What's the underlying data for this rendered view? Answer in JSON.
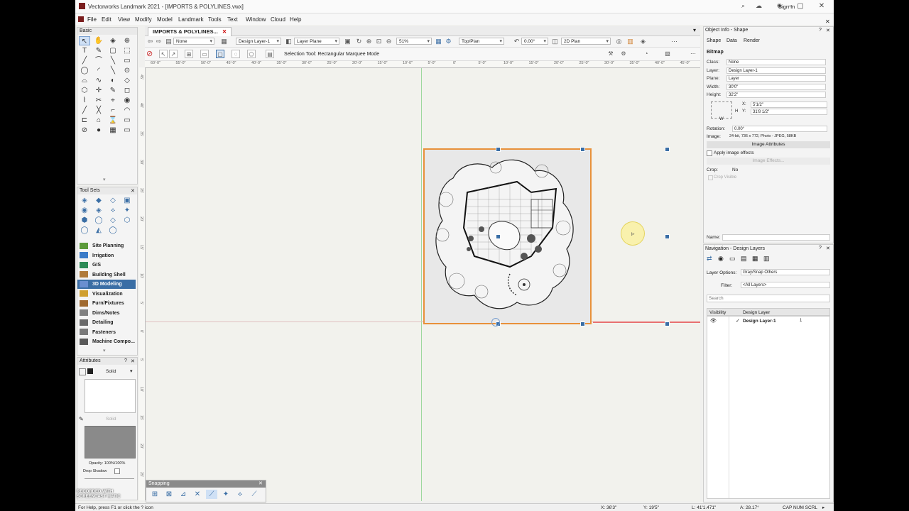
{
  "window": {
    "title": "Vectorworks Landmark 2021 - [IMPORTS & POLYLINES.vwx]",
    "sign_in": "Sign In"
  },
  "menu": [
    "File",
    "Edit",
    "View",
    "Modify",
    "Model",
    "Landmark",
    "Tools",
    "Text",
    "Window",
    "Cloud",
    "Help"
  ],
  "doc_tab": {
    "label": "IMPORTS & POLYLINES..."
  },
  "view_bar": {
    "class_value": "None",
    "layer_value": "Design Layer-1",
    "plane_value": "Layer Plane",
    "zoom_value": "51%",
    "view_value": "Top/Plan",
    "rotation_value": "0.00°",
    "render_value": "2D Plan"
  },
  "mode_bar": {
    "message": "Selection Tool: Rectangular Marquee Mode"
  },
  "ruler": {
    "h_labels": [
      "60'-0\"",
      "55'-0\"",
      "50'-0\"",
      "45'-0\"",
      "40'-0\"",
      "35'-0\"",
      "30'-0\"",
      "25'-0\"",
      "20'-0\"",
      "15'-0\"",
      "10'-0\"",
      "5'-0\"",
      "0'",
      "5'-0\"",
      "10'-0\"",
      "15'-0\"",
      "20'-0\"",
      "25'-0\"",
      "30'-0\"",
      "35'-0\"",
      "40'-0\"",
      "45'-0\""
    ],
    "v_labels": [
      "45'",
      "40'",
      "35'",
      "30'",
      "25'",
      "20'",
      "15'",
      "10'",
      "5'",
      "0'",
      "5'",
      "10'",
      "15'",
      "20'",
      "25'"
    ]
  },
  "basic_palette": {
    "title": "Basic"
  },
  "tool_sets": {
    "title": "Tool Sets",
    "items": [
      {
        "label": "Site Planning",
        "color": "#5b9a3a",
        "active": false
      },
      {
        "label": "Irrigation",
        "color": "#3a7bc8",
        "active": false
      },
      {
        "label": "GIS",
        "color": "#2e8b57",
        "active": false
      },
      {
        "label": "Building Shell",
        "color": "#b07a3a",
        "active": false
      },
      {
        "label": "3D Modeling",
        "color": "#6a8fd0",
        "active": true
      },
      {
        "label": "Visualization",
        "color": "#d0a030",
        "active": false
      },
      {
        "label": "Furn/Fixtures",
        "color": "#a06a30",
        "active": false
      },
      {
        "label": "Dims/Notes",
        "color": "#808080",
        "active": false
      },
      {
        "label": "Detailing",
        "color": "#6a6a6a",
        "active": false
      },
      {
        "label": "Fasteners",
        "color": "#7a7a7a",
        "active": false
      },
      {
        "label": "Machine Compo...",
        "color": "#5a5a5a",
        "active": false
      }
    ]
  },
  "attributes": {
    "title": "Attributes",
    "fill_style": "Solid",
    "pen_style": "Solid",
    "opacity": "Opacity: 100%/100%",
    "drop_shadow": "Drop Shadow"
  },
  "snapping": {
    "title": "Snapping"
  },
  "object_info": {
    "title": "Object Info - Shape",
    "tabs": [
      "Shape",
      "Data",
      "Render"
    ],
    "object_type": "Bitmap",
    "rows": [
      {
        "label": "Class:",
        "value": "None"
      },
      {
        "label": "Layer:",
        "value": "Design Layer-1"
      },
      {
        "label": "Plane:",
        "value": "Layer"
      },
      {
        "label": "Width:",
        "value": "30'0\""
      },
      {
        "label": "Height:",
        "value": "32'2\""
      }
    ],
    "x_label": "X:",
    "x_value": "5'1/2\"",
    "y_label": "Y:",
    "y_value": "31'8 1/2\"",
    "h_label": "H",
    "w_label": "W",
    "rotation_label": "Rotation:",
    "rotation_value": "0.00°",
    "image_label": "Image:",
    "image_value": "24-bit, 736 x 772, Photo - JPEG, 58KB",
    "image_attributes_btn": "Image Attributes",
    "apply_effects": "Apply image effects",
    "image_effects_btn": "Image Effects...",
    "crop_label": "Crop:",
    "crop_value": "No",
    "crop_visible": "Crop Visible",
    "name_label": "Name:"
  },
  "navigation": {
    "title": "Navigation - Design Layers",
    "layer_options_label": "Layer Options:",
    "layer_options_value": "Gray/Snap Others",
    "filter_label": "Filter:",
    "filter_value": "<All Layers>",
    "search_placeholder": "Search",
    "col_visibility": "Visibility",
    "col_design_layer": "Design Layer",
    "layers": [
      {
        "name": "Design Layer-1",
        "number": "1"
      }
    ]
  },
  "status_bar": {
    "help_text": "For Help, press F1 or click the ? icon",
    "x": "X: 36'3\"",
    "y": "Y: 19'5\"",
    "l": "L: 41'1.471\"",
    "a": "A: 28.17°",
    "indicators": "CAP NUM SCRL"
  },
  "watermark": "RECORDED WITH SCREENCAST MATIC",
  "colors": {
    "selection": "#e8913a",
    "accent": "#3a6ea5"
  }
}
